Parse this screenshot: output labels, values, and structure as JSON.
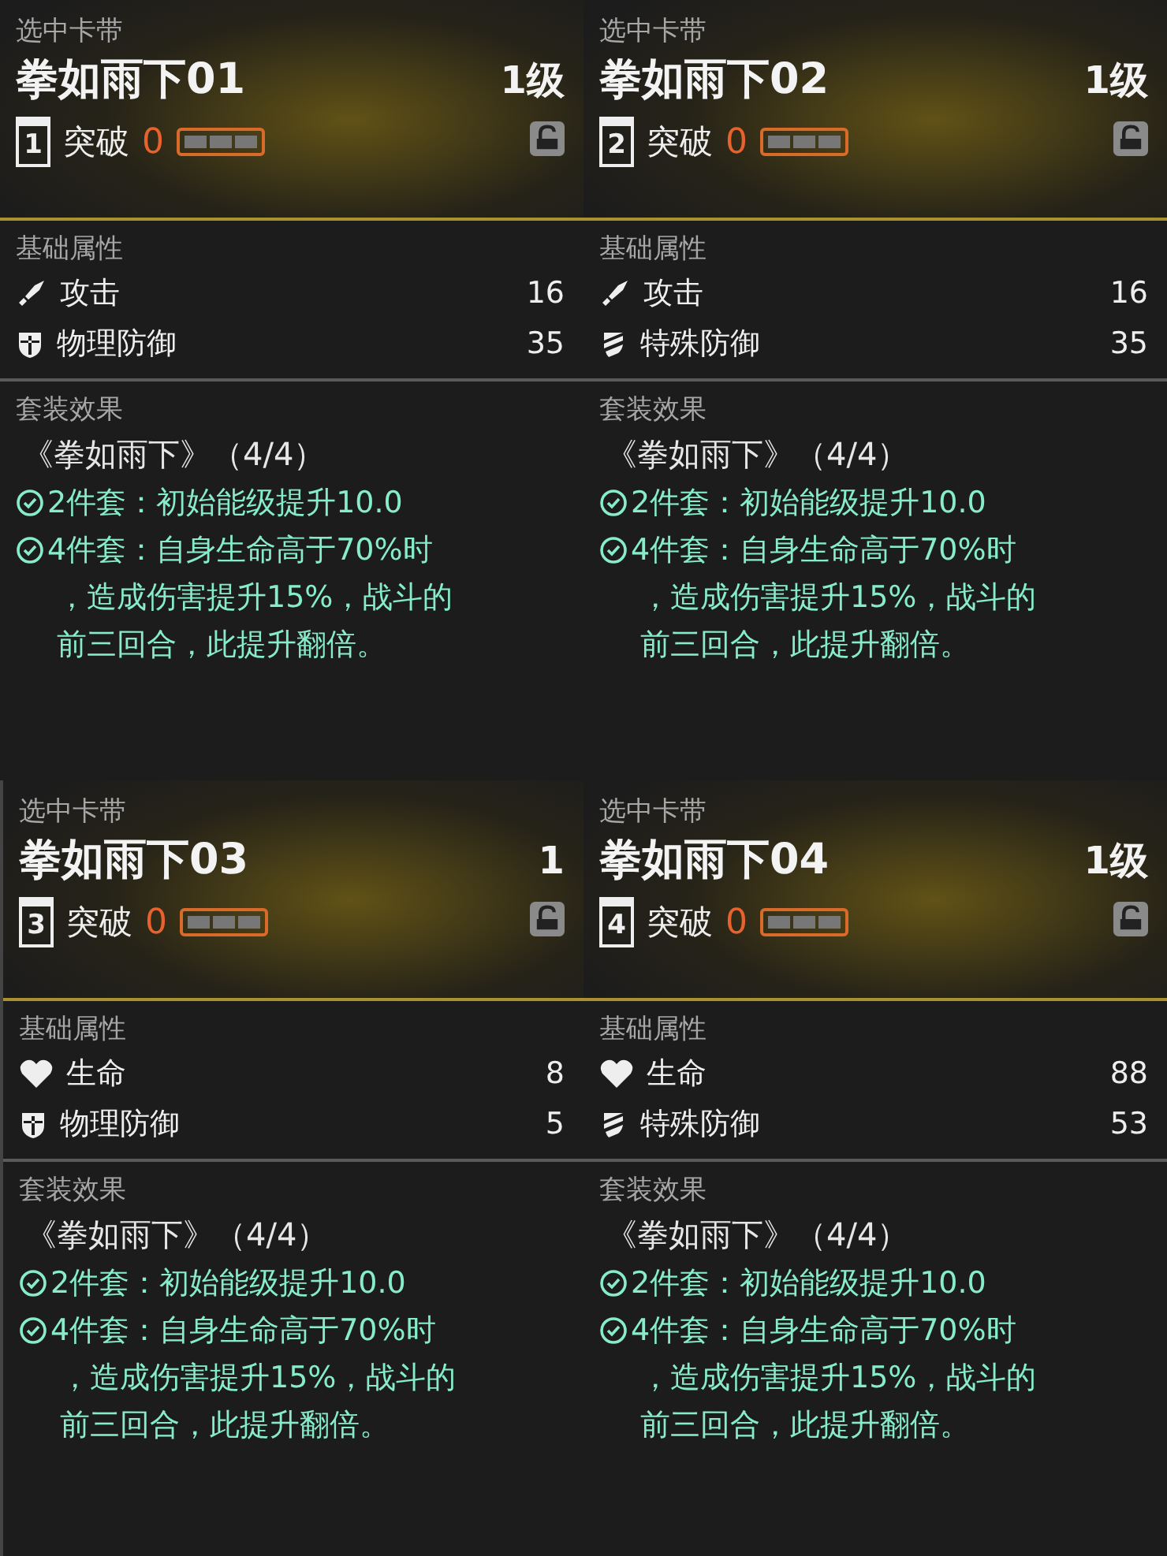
{
  "panels": [
    {
      "header_label": "选中卡带",
      "name": "拳如雨下01",
      "level": "1级",
      "slot": "1",
      "breakthrough_label": "突破",
      "breakthrough_value": "0",
      "locked": false,
      "stats_title": "基础属性",
      "stats": [
        {
          "kind": "attack",
          "name": "攻击",
          "value": "16"
        },
        {
          "kind": "physical_defense",
          "name": "物理防御",
          "value": "35"
        }
      ],
      "set_title": "套装效果",
      "set_name": "《拳如雨下》（4/4）",
      "effects": [
        {
          "active": true,
          "lines": [
            "2件套：初始能级提升10.0"
          ]
        },
        {
          "active": true,
          "lines": [
            "4件套：自身生命高于70%时",
            "，造成伤害提升15%，战斗的",
            "前三回合，此提升翻倍。"
          ]
        }
      ]
    },
    {
      "header_label": "选中卡带",
      "name": "拳如雨下02",
      "level": "1级",
      "slot": "2",
      "breakthrough_label": "突破",
      "breakthrough_value": "0",
      "locked": false,
      "stats_title": "基础属性",
      "stats": [
        {
          "kind": "attack",
          "name": "攻击",
          "value": "16"
        },
        {
          "kind": "special_defense",
          "name": "特殊防御",
          "value": "35"
        }
      ],
      "set_title": "套装效果",
      "set_name": "《拳如雨下》（4/4）",
      "effects": [
        {
          "active": true,
          "lines": [
            "2件套：初始能级提升10.0"
          ]
        },
        {
          "active": true,
          "lines": [
            "4件套：自身生命高于70%时",
            "，造成伤害提升15%，战斗的",
            "前三回合，此提升翻倍。"
          ]
        }
      ]
    },
    {
      "header_label": "选中卡带",
      "name": "拳如雨下03",
      "level": "1",
      "slot": "3",
      "breakthrough_label": "突破",
      "breakthrough_value": "0",
      "locked": false,
      "stats_title": "基础属性",
      "stats": [
        {
          "kind": "hp",
          "name": "生命",
          "value": "8"
        },
        {
          "kind": "physical_defense",
          "name": "物理防御",
          "value": "5"
        }
      ],
      "set_title": "套装效果",
      "set_name": "《拳如雨下》（4/4）",
      "effects": [
        {
          "active": true,
          "lines": [
            "2件套：初始能级提升10.0"
          ]
        },
        {
          "active": true,
          "lines": [
            "4件套：自身生命高于70%时",
            "，造成伤害提升15%，战斗的",
            "前三回合，此提升翻倍。"
          ]
        }
      ]
    },
    {
      "header_label": "选中卡带",
      "name": "拳如雨下04",
      "level": "1级",
      "slot": "4",
      "breakthrough_label": "突破",
      "breakthrough_value": "0",
      "locked": false,
      "stats_title": "基础属性",
      "stats": [
        {
          "kind": "hp",
          "name": "生命",
          "value": "88"
        },
        {
          "kind": "special_defense",
          "name": "特殊防御",
          "value": "53"
        }
      ],
      "set_title": "套装效果",
      "set_name": "《拳如雨下》（4/4）",
      "effects": [
        {
          "active": true,
          "lines": [
            "2件套：初始能级提升10.0"
          ]
        },
        {
          "active": true,
          "lines": [
            "4件套：自身生命高于70%时",
            "，造成伤害提升15%，战斗的",
            "前三回合，此提升翻倍。"
          ]
        }
      ]
    }
  ]
}
